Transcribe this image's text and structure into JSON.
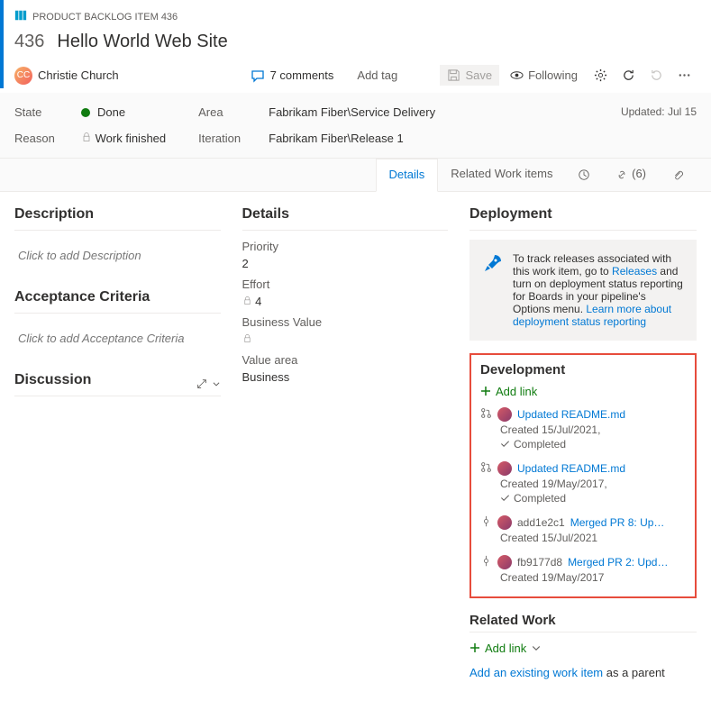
{
  "header": {
    "type_label": "PRODUCT BACKLOG ITEM 436",
    "id": "436",
    "title": "Hello World Web Site",
    "assignee": "Christie Church",
    "comments_count": "7 comments",
    "add_tag": "Add tag",
    "save": "Save",
    "follow": "Following"
  },
  "fields": {
    "state_label": "State",
    "state_value": "Done",
    "reason_label": "Reason",
    "reason_value": "Work finished",
    "area_label": "Area",
    "area_value": "Fabrikam Fiber\\Service Delivery",
    "iteration_label": "Iteration",
    "iteration_value": "Fabrikam Fiber\\Release 1",
    "updated": "Updated: Jul 15"
  },
  "tabs": {
    "details": "Details",
    "related": "Related Work items",
    "links_count": "(6)"
  },
  "left": {
    "description_title": "Description",
    "description_placeholder": "Click to add Description",
    "acceptance_title": "Acceptance Criteria",
    "acceptance_placeholder": "Click to add Acceptance Criteria",
    "discussion_title": "Discussion"
  },
  "details": {
    "title": "Details",
    "priority_label": "Priority",
    "priority_value": "2",
    "effort_label": "Effort",
    "effort_value": "4",
    "bv_label": "Business Value",
    "va_label": "Value area",
    "va_value": "Business"
  },
  "deployment": {
    "title": "Deployment",
    "text1": "To track releases associated with this work item, go to ",
    "link1": "Releases",
    "text2": " and turn on deployment status reporting for Boards in your pipeline's Options menu. ",
    "link2": "Learn more about deployment status reporting"
  },
  "development": {
    "title": "Development",
    "add_link": "Add link",
    "items": [
      {
        "type": "pr",
        "linktext": "Updated README.md",
        "created": "Created 15/Jul/2021,",
        "status": "Completed"
      },
      {
        "type": "pr",
        "linktext": "Updated README.md",
        "created": "Created 19/May/2017,",
        "status": "Completed"
      },
      {
        "type": "commit",
        "hash": "add1e2c1",
        "linktext": "Merged PR 8: Up…",
        "created": "Created 15/Jul/2021"
      },
      {
        "type": "commit",
        "hash": "fb9177d8",
        "linktext": "Merged PR 2: Upd…",
        "created": "Created 19/May/2017"
      }
    ]
  },
  "related": {
    "title": "Related Work",
    "add_link": "Add link",
    "add_existing": "Add an existing work item",
    "suffix": " as a parent"
  }
}
